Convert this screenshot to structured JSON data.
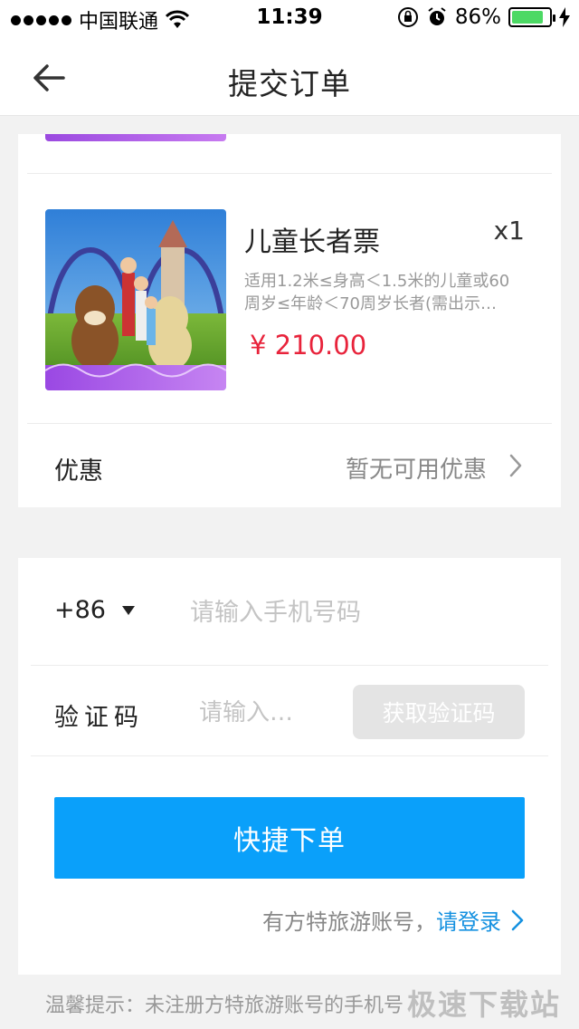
{
  "status_bar": {
    "carrier": "中国联通",
    "time": "11:39",
    "battery": "86%",
    "battery_level": 0.86
  },
  "nav": {
    "title": "提交订单"
  },
  "product": {
    "name": "儿童长者票",
    "quantity": "x1",
    "desc_line1": "适用1.2米≤身高＜1.5米的儿童或60",
    "desc_line2": "周岁≤年龄＜70周岁长者(需出示…",
    "price": "¥ 210.00"
  },
  "discount": {
    "label": "优惠",
    "value": "暂无可用优惠"
  },
  "form": {
    "country_code": "+86",
    "phone_placeholder": "请输入手机号码",
    "code_label": "验证码",
    "code_placeholder": "请输入…",
    "get_code_label": "获取验证码",
    "submit_label": "快捷下单",
    "login_prompt": "有方特旅游账号，",
    "login_link": "请登录"
  },
  "tip": "温馨提示：未注册方特旅游账号的手机号",
  "watermark": "极速下载站",
  "colors": {
    "price": "#e8233b",
    "primary_button": "#0aa0fa",
    "link": "#1591e0",
    "battery": "#4cd964"
  }
}
